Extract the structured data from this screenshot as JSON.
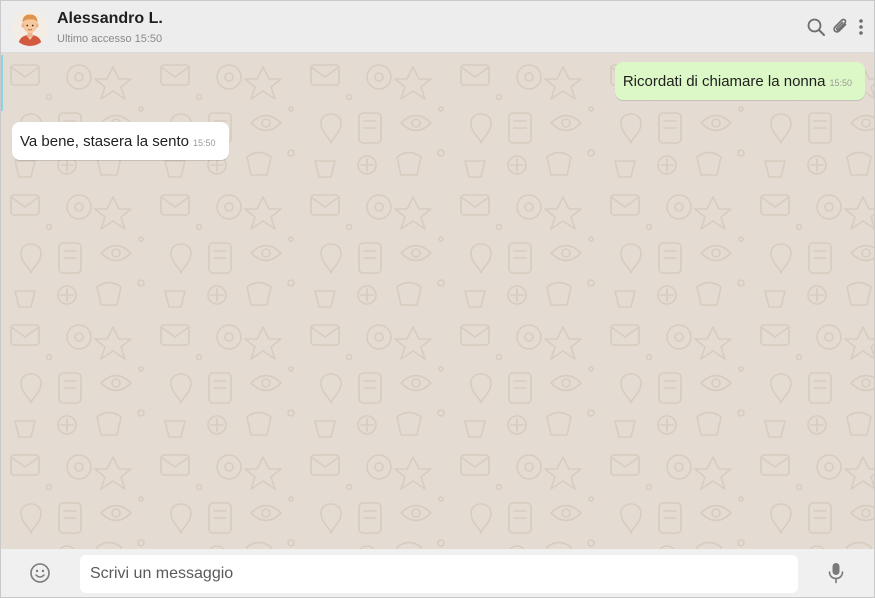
{
  "header": {
    "contact_name": "Alessandro L.",
    "last_seen": "Ultimo accesso 15:50",
    "icons": [
      "search-icon",
      "paperclip-icon",
      "more-vertical-icon"
    ]
  },
  "messages": [
    {
      "direction": "outgoing",
      "text": "Ricordati di chiamare la nonna",
      "time": "15:50"
    },
    {
      "direction": "incoming",
      "text": "Va bene, stasera la sento",
      "time": "15:50"
    }
  ],
  "composer": {
    "placeholder": "Scrivi un messaggio",
    "value": "",
    "icons": [
      "emoji-icon",
      "microphone-icon"
    ]
  },
  "colors": {
    "header_bg": "#ededed",
    "chat_bg": "#e4dcd3",
    "outgoing_bubble": "#dcf8c6",
    "incoming_bubble": "#ffffff",
    "footer_bg": "#f0f0f0"
  }
}
